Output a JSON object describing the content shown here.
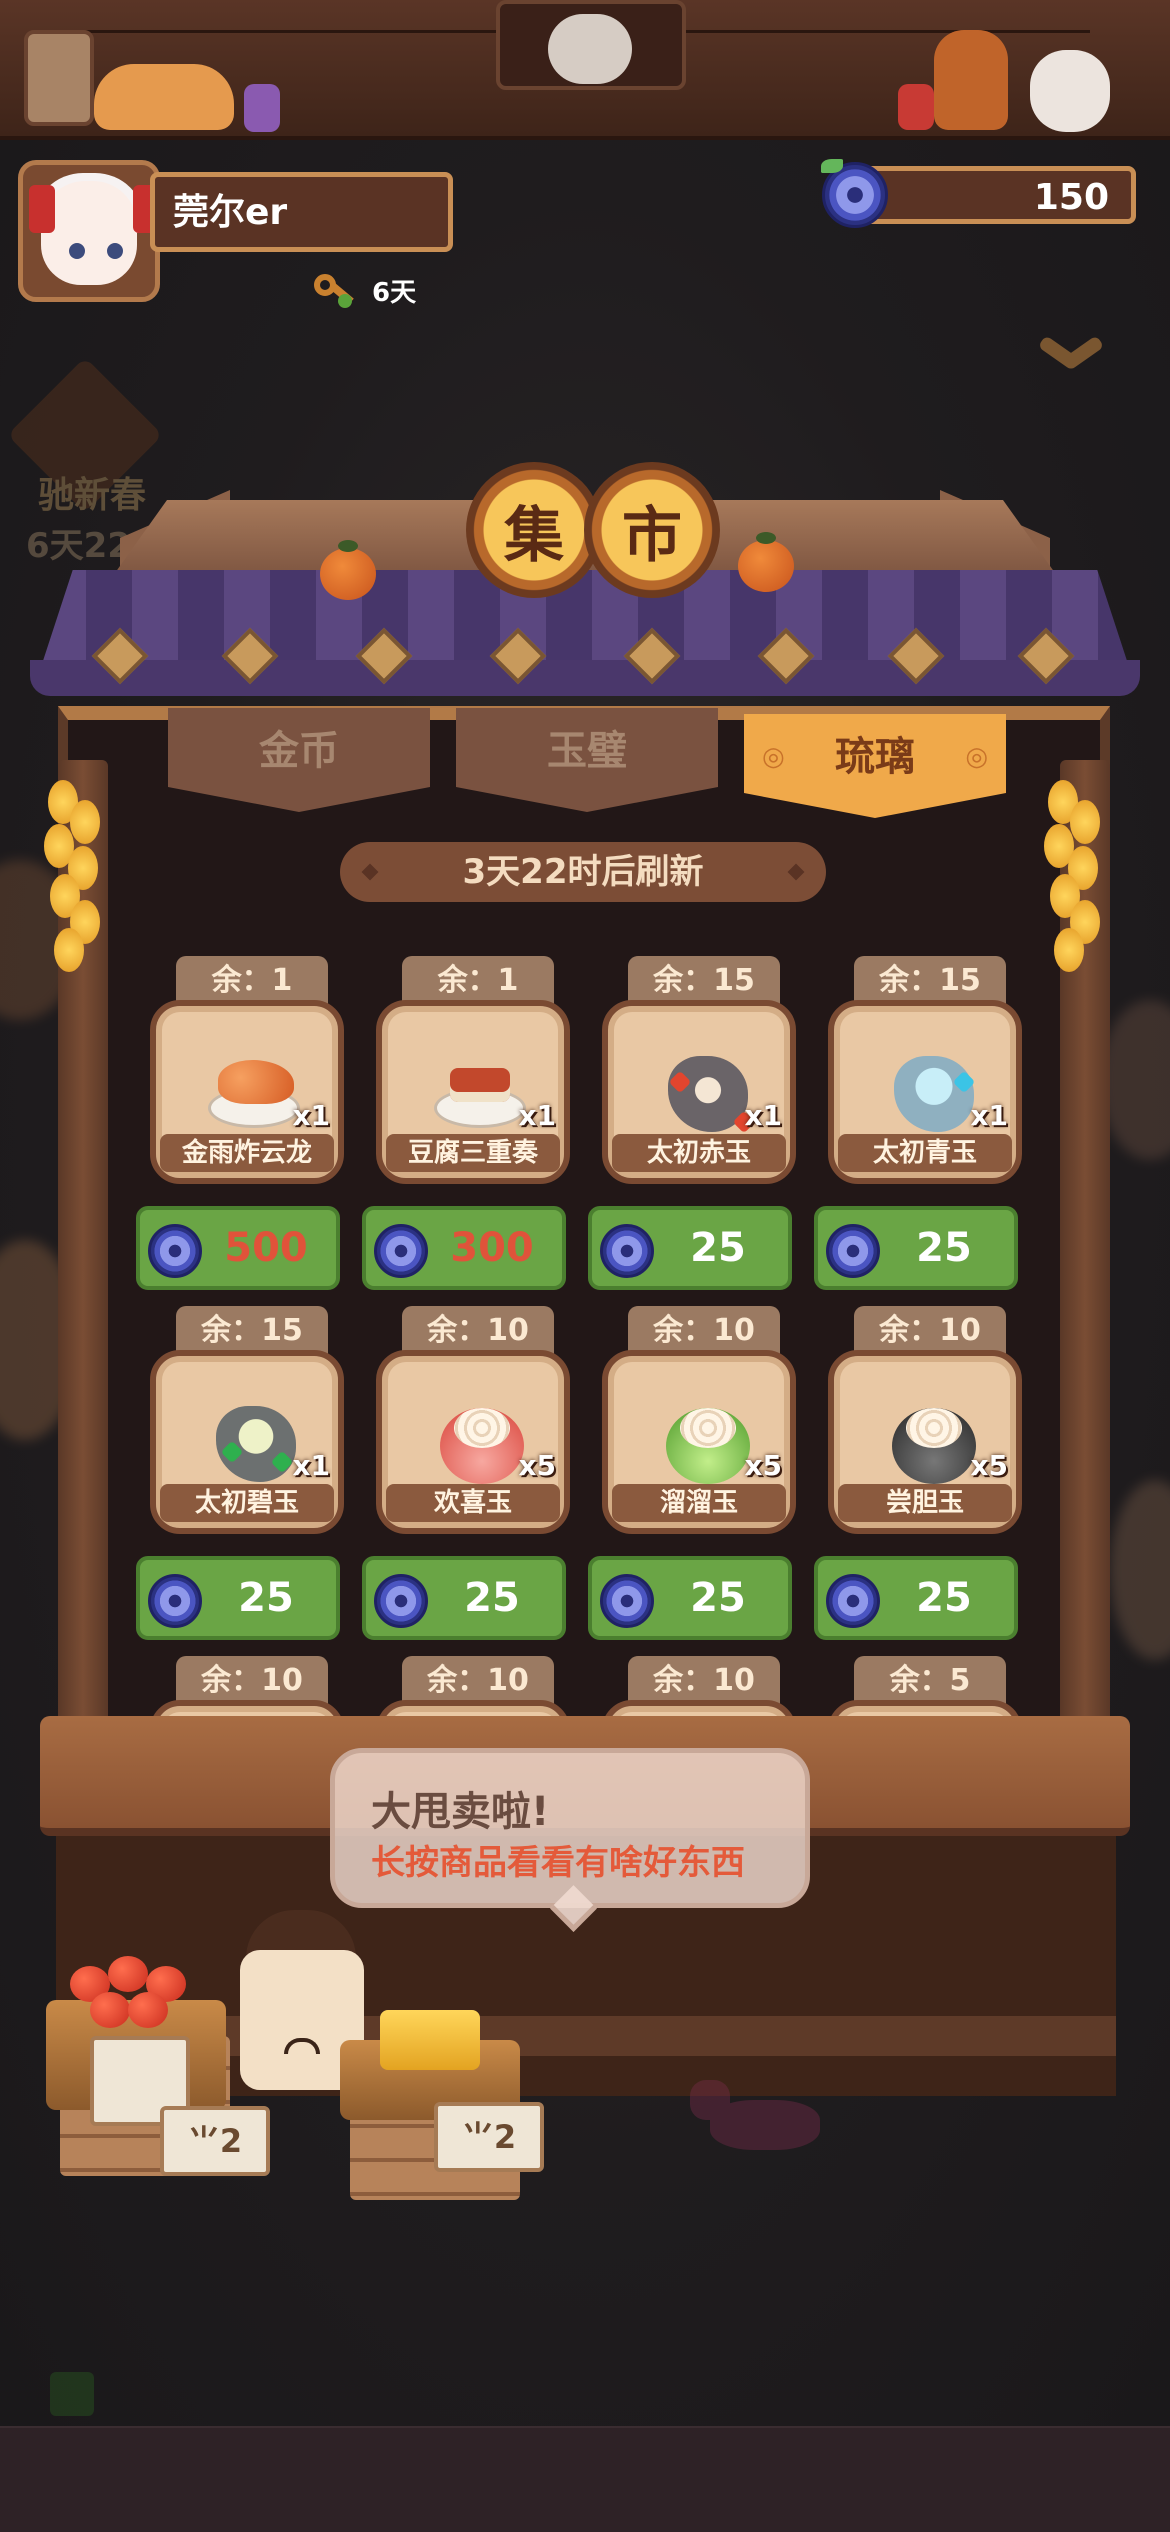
{
  "player": {
    "name": "莞尔er",
    "days": "6天",
    "currency_amount": "150"
  },
  "event": {
    "title": "驰新春",
    "timer": "6天22"
  },
  "market": {
    "title_chars": [
      "集",
      "市"
    ],
    "tabs": [
      {
        "label": "金币",
        "active": false
      },
      {
        "label": "玉璧",
        "active": false
      },
      {
        "label": "琉璃",
        "active": true
      }
    ],
    "refresh_text": "3天22时后刷新",
    "items": [
      {
        "stock": "余：1",
        "name": "金雨炸云龙",
        "qty": "x1",
        "price": "500",
        "affordable": false,
        "pic": "fried-shrimp-dish"
      },
      {
        "stock": "余：1",
        "name": "豆腐三重奏",
        "qty": "x1",
        "price": "300",
        "affordable": false,
        "pic": "tofu-dish"
      },
      {
        "stock": "余：15",
        "name": "太初赤玉",
        "qty": "x1",
        "price": "25",
        "affordable": true,
        "pic": "red-jade-ore"
      },
      {
        "stock": "余：15",
        "name": "太初青玉",
        "qty": "x1",
        "price": "25",
        "affordable": true,
        "pic": "blue-jade-ore"
      },
      {
        "stock": "余：15",
        "name": "太初碧玉",
        "qty": "x1",
        "price": "25",
        "affordable": true,
        "pic": "green-jade-ore"
      },
      {
        "stock": "余：10",
        "name": "欢喜玉",
        "qty": "x5",
        "price": "25",
        "affordable": true,
        "pic": "pink-swirl-jade"
      },
      {
        "stock": "余：10",
        "name": "溜溜玉",
        "qty": "x5",
        "price": "25",
        "affordable": true,
        "pic": "green-swirl-jade"
      },
      {
        "stock": "余：10",
        "name": "尝胆玉",
        "qty": "x5",
        "price": "25",
        "affordable": true,
        "pic": "black-swirl-jade"
      },
      {
        "stock": "余：10"
      },
      {
        "stock": "余：10"
      },
      {
        "stock": "余：10"
      },
      {
        "stock": "余：5"
      }
    ]
  },
  "bubble": {
    "line1": "大甩卖啦!",
    "line2": "长按商品看看有啥好东西"
  },
  "signs": [
    "⺌2",
    "⺌2"
  ],
  "colors": {
    "price_green": "#6aa545",
    "price_short_red": "#e0533a",
    "active_tab": "#f0a94a",
    "roof_purple": "#5b4780"
  }
}
